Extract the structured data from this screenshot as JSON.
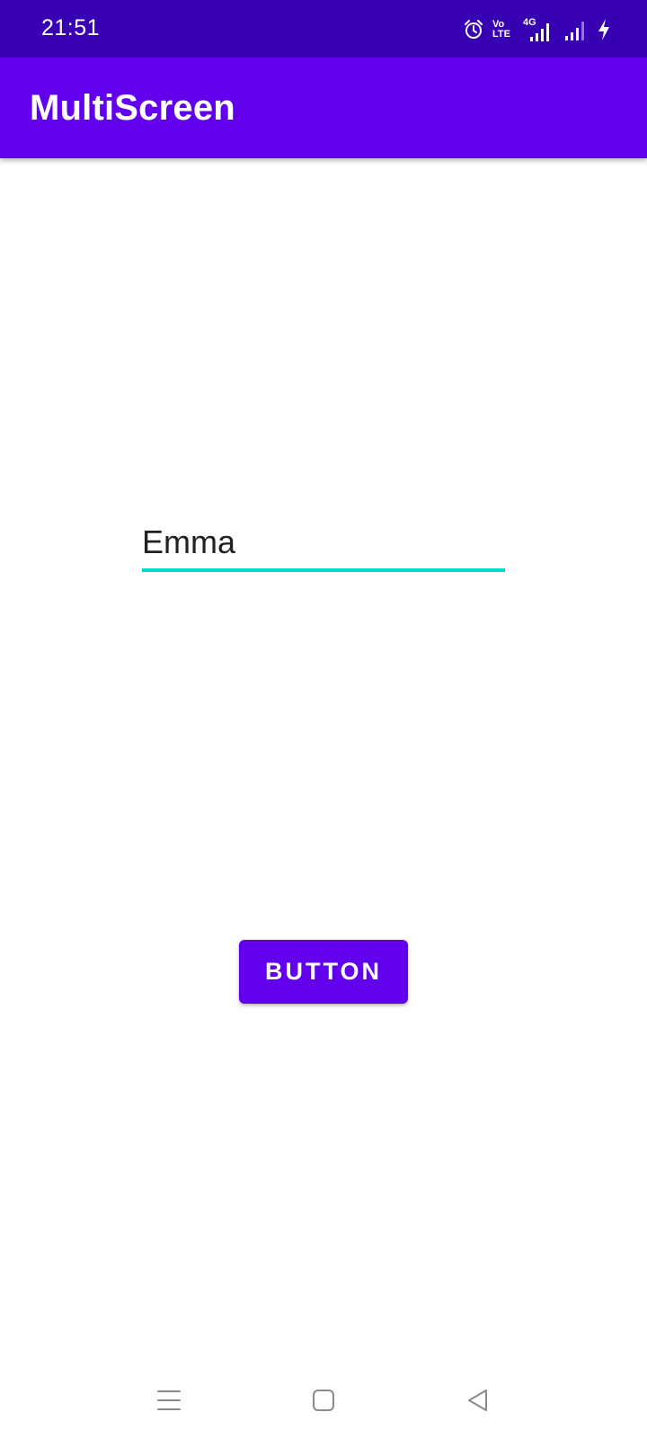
{
  "status_bar": {
    "time": "21:51",
    "volte_top": "Vo",
    "volte_bottom": "LTE",
    "network_label": "4G",
    "icons": [
      "alarm-icon",
      "volte-icon",
      "signal-4g-icon",
      "signal-icon",
      "charging-icon"
    ]
  },
  "app_bar": {
    "title": "MultiScreen"
  },
  "form": {
    "name_value": "Emma"
  },
  "main": {
    "button_label": "BUTTON"
  },
  "nav_bar": {
    "icons": [
      "menu-icon",
      "home-icon",
      "back-icon"
    ]
  },
  "colors": {
    "status_bar": "#3700b3",
    "primary": "#6200ee",
    "accent": "#03dac5",
    "background": "#ffffff",
    "text": "#212121"
  }
}
